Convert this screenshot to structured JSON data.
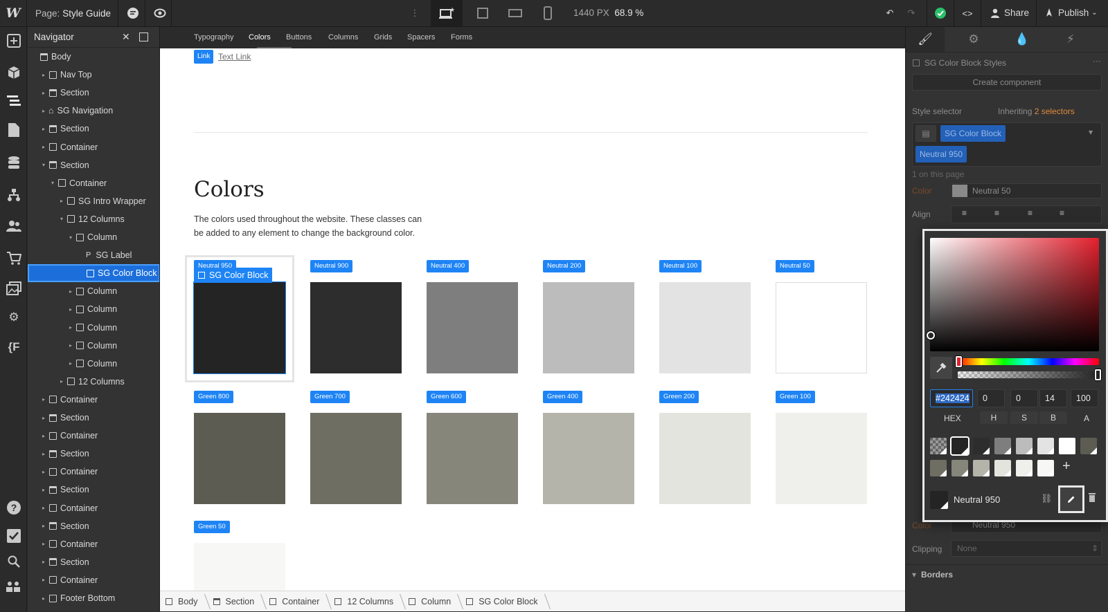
{
  "topbar": {
    "page_prefix": "Page:",
    "page_name": "Style Guide",
    "viewport_width": "1440 PX",
    "zoom": "68.9 %",
    "share_label": "Share",
    "publish_label": "Publish"
  },
  "navigator": {
    "title": "Navigator",
    "items": [
      {
        "label": "Body",
        "depth": 0,
        "tri": "",
        "icon": "box-sec"
      },
      {
        "label": "Nav Top",
        "depth": 1,
        "tri": "▸",
        "icon": "box"
      },
      {
        "label": "Section",
        "depth": 1,
        "tri": "▸",
        "icon": "sec"
      },
      {
        "label": "SG Navigation",
        "depth": 1,
        "tri": "▸",
        "icon": "home"
      },
      {
        "label": "Section",
        "depth": 1,
        "tri": "▸",
        "icon": "sec"
      },
      {
        "label": "Container",
        "depth": 1,
        "tri": "▸",
        "icon": "box"
      },
      {
        "label": "Section",
        "depth": 1,
        "tri": "▾",
        "icon": "sec"
      },
      {
        "label": "Container",
        "depth": 2,
        "tri": "▾",
        "icon": "box"
      },
      {
        "label": "SG Intro Wrapper",
        "depth": 3,
        "tri": "▸",
        "icon": "box"
      },
      {
        "label": "12 Columns",
        "depth": 3,
        "tri": "▾",
        "icon": "box"
      },
      {
        "label": "Column",
        "depth": 4,
        "tri": "▾",
        "icon": "box"
      },
      {
        "label": "SG Label",
        "depth": 5,
        "tri": "",
        "icon": "p"
      },
      {
        "label": "SG Color Block",
        "depth": 5,
        "tri": "",
        "icon": "box",
        "selected": true
      },
      {
        "label": "Column",
        "depth": 4,
        "tri": "▸",
        "icon": "box"
      },
      {
        "label": "Column",
        "depth": 4,
        "tri": "▸",
        "icon": "box"
      },
      {
        "label": "Column",
        "depth": 4,
        "tri": "▸",
        "icon": "box"
      },
      {
        "label": "Column",
        "depth": 4,
        "tri": "▸",
        "icon": "box"
      },
      {
        "label": "Column",
        "depth": 4,
        "tri": "▸",
        "icon": "box"
      },
      {
        "label": "12 Columns",
        "depth": 3,
        "tri": "▸",
        "icon": "box"
      },
      {
        "label": "Container",
        "depth": 1,
        "tri": "▸",
        "icon": "box"
      },
      {
        "label": "Section",
        "depth": 1,
        "tri": "▸",
        "icon": "sec"
      },
      {
        "label": "Container",
        "depth": 1,
        "tri": "▸",
        "icon": "box"
      },
      {
        "label": "Section",
        "depth": 1,
        "tri": "▸",
        "icon": "sec"
      },
      {
        "label": "Container",
        "depth": 1,
        "tri": "▸",
        "icon": "box"
      },
      {
        "label": "Section",
        "depth": 1,
        "tri": "▸",
        "icon": "sec"
      },
      {
        "label": "Container",
        "depth": 1,
        "tri": "▸",
        "icon": "box"
      },
      {
        "label": "Section",
        "depth": 1,
        "tri": "▸",
        "icon": "sec"
      },
      {
        "label": "Container",
        "depth": 1,
        "tri": "▸",
        "icon": "box"
      },
      {
        "label": "Section",
        "depth": 1,
        "tri": "▸",
        "icon": "sec"
      },
      {
        "label": "Container",
        "depth": 1,
        "tri": "▸",
        "icon": "box"
      },
      {
        "label": "Footer Bottom",
        "depth": 1,
        "tri": "▸",
        "icon": "box"
      }
    ]
  },
  "canvas": {
    "tabs": [
      "Typography",
      "Colors",
      "Buttons",
      "Columns",
      "Grids",
      "Spacers",
      "Forms"
    ],
    "active_tab": "Colors",
    "link_badge": "Link",
    "text_link": "Text Link",
    "heading": "Colors",
    "description": "The colors used throughout the website. These classes can be added to any element to change the background color.",
    "selected_tag": "SG Color Block",
    "swatches": [
      {
        "label": "Neutral 950",
        "color": "#242424"
      },
      {
        "label": "Neutral 900",
        "color": "#2d2d2d"
      },
      {
        "label": "Neutral 400",
        "color": "#7e7e7e"
      },
      {
        "label": "Neutral 200",
        "color": "#bcbcbc"
      },
      {
        "label": "Neutral 100",
        "color": "#e3e3e3"
      },
      {
        "label": "Neutral 50",
        "color": "#ffffff"
      },
      {
        "label": "Green 800",
        "color": "#5c5c52"
      },
      {
        "label": "Green 700",
        "color": "#6e6e62"
      },
      {
        "label": "Green 600",
        "color": "#86867a"
      },
      {
        "label": "Green 400",
        "color": "#b4b4ab"
      },
      {
        "label": "Green 200",
        "color": "#e4e4de"
      },
      {
        "label": "Green 100",
        "color": "#efefec"
      },
      {
        "label": "Green 50",
        "color": "#f7f7f6"
      }
    ]
  },
  "breadcrumb": [
    {
      "label": "Body",
      "icon": "box"
    },
    {
      "label": "Section",
      "icon": "sec"
    },
    {
      "label": "Container",
      "icon": "box"
    },
    {
      "label": "12 Columns",
      "icon": "box"
    },
    {
      "label": "Column",
      "icon": "box"
    },
    {
      "label": "SG Color Block",
      "icon": "box"
    }
  ],
  "style_panel": {
    "component_title": "SG Color Block Styles",
    "create_component": "Create component",
    "style_selector": "Style selector",
    "inheriting": "Inheriting",
    "inheriting_count": "2 selectors",
    "class_chip": "SG Color Block",
    "combo_chip": "Neutral 950",
    "on_page": "1 on this page",
    "color_label": "Color",
    "color_value": "Neutral 50",
    "align_label": "Align",
    "bg_color_label": "Color",
    "bg_color_value": "Neutral 950",
    "clipping_label": "Clipping",
    "clipping_value": "None",
    "borders_label": "Borders"
  },
  "color_picker": {
    "hex": "#242424",
    "h": "0",
    "s": "0",
    "b": "14",
    "a": "100",
    "labels": [
      "HEX",
      "H",
      "S",
      "B",
      "A"
    ],
    "swatch_name": "Neutral 950",
    "swatch_colors": [
      "transparent",
      "#242424",
      "#2d2d2d",
      "#7e7e7e",
      "#bcbcbc",
      "#e3e3e3",
      "#ffffff",
      "#5c5c52",
      "#6e6e62",
      "#86867a",
      "#b4b4ab",
      "#e4e4de",
      "#efefec",
      "#f7f7f6"
    ]
  }
}
